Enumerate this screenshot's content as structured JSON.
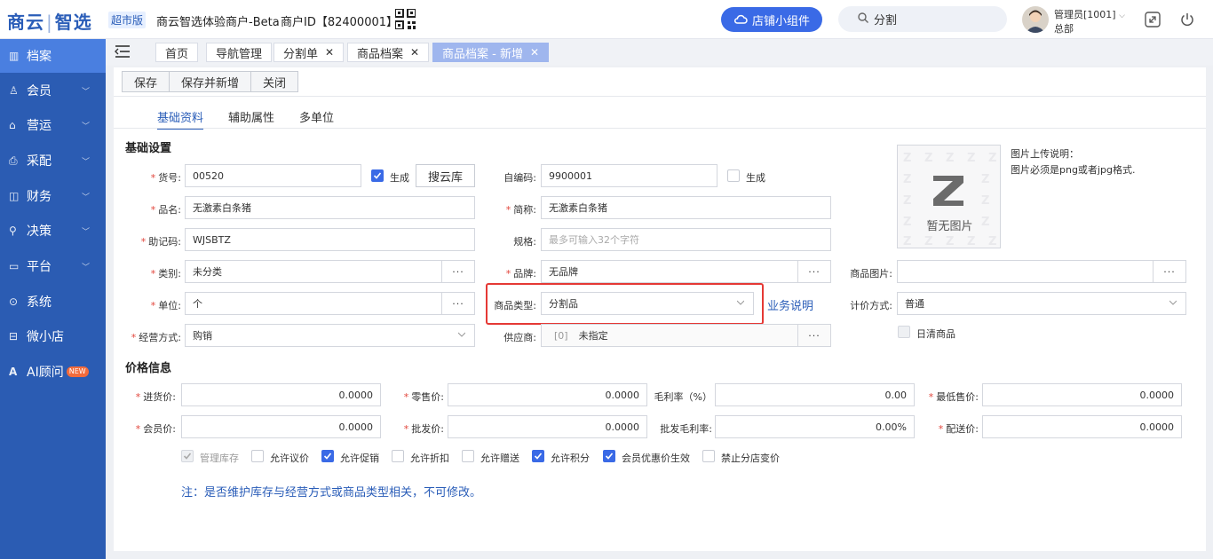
{
  "header": {
    "logo_left": "商云",
    "logo_right": "智选",
    "edition": "超市版",
    "merchant": "商云智选体验商户-Beta",
    "merchant_id": "商户ID【82400001】",
    "widget_button": "店铺小组件",
    "search_value": "分割",
    "user_name": "管理员[1001]",
    "user_org": "总部"
  },
  "sidebar": {
    "items": [
      {
        "label": "档案",
        "icon": "archive-icon"
      },
      {
        "label": "会员",
        "icon": "member-icon"
      },
      {
        "label": "营运",
        "icon": "store-icon"
      },
      {
        "label": "采配",
        "icon": "purchase-icon"
      },
      {
        "label": "财务",
        "icon": "finance-icon"
      },
      {
        "label": "决策",
        "icon": "decision-icon"
      },
      {
        "label": "平台",
        "icon": "platform-icon"
      },
      {
        "label": "系统",
        "icon": "system-icon"
      },
      {
        "label": "微小店",
        "icon": "microshop-icon"
      },
      {
        "label": "AI顾问",
        "icon": "ai-icon",
        "badge": "NEW"
      }
    ]
  },
  "tabs": [
    {
      "label": "首页"
    },
    {
      "label": "导航管理"
    },
    {
      "label": "分割单"
    },
    {
      "label": "商品档案"
    },
    {
      "label": "商品档案 - 新增"
    }
  ],
  "toolbar": {
    "save": "保存",
    "save_new": "保存并新增",
    "close": "关闭"
  },
  "subtabs": [
    "基础资料",
    "辅助属性",
    "多单位"
  ],
  "basic": {
    "title": "基础设置",
    "code_label": "货号:",
    "code_value": "00520",
    "generate_label": "生成",
    "search_lib_button": "搜云库",
    "barcode_label": "自编码:",
    "barcode_value": "9900001",
    "generate2_label": "生成",
    "name_label": "品名:",
    "name_value": "无激素白条猪",
    "short_label": "简称:",
    "short_value": "无激素白条猪",
    "mnemonic_label": "助记码:",
    "mnemonic_value": "WJSBTZ",
    "spec_label": "规格:",
    "spec_placeholder": "最多可输入32个字符",
    "category_label": "类别:",
    "category_value": "未分类",
    "brand_label": "品牌:",
    "brand_value": "无品牌",
    "image_label": "商品图片:",
    "unit_label": "单位:",
    "unit_value": "个",
    "type_label": "商品类型:",
    "type_value": "分割品",
    "business_link": "业务说明",
    "pricing_label": "计价方式:",
    "pricing_value": "普通",
    "mode_label": "经营方式:",
    "mode_value": "购销",
    "supplier_label": "供应商:",
    "supplier_code": "[0]",
    "supplier_value": "未指定",
    "daily_clear_label": "日清商品",
    "ellipsis": "···"
  },
  "image": {
    "no_image": "暂无图片",
    "note_title": "图片上传说明：",
    "note_body": "图片必须是png或者jpg格式."
  },
  "price": {
    "title": "价格信息",
    "purchase_label": "进货价:",
    "purchase_value": "0.0000",
    "retail_label": "零售价:",
    "retail_value": "0.0000",
    "margin_label": "毛利率（%）",
    "margin_value": "0.00",
    "min_label": "最低售价:",
    "min_value": "0.0000",
    "member_label": "会员价:",
    "member_value": "0.0000",
    "wholesale_label": "批发价:",
    "wholesale_value": "0.0000",
    "wholesale_margin_label": "批发毛利率:",
    "wholesale_margin_value": "0.00%",
    "delivery_label": "配送价:",
    "delivery_value": "0.0000"
  },
  "options": [
    {
      "label": "管理库存",
      "checked": true,
      "disabled": true
    },
    {
      "label": "允许议价",
      "checked": false
    },
    {
      "label": "允许促销",
      "checked": true
    },
    {
      "label": "允许折扣",
      "checked": false
    },
    {
      "label": "允许赠送",
      "checked": false
    },
    {
      "label": "允许积分",
      "checked": true
    },
    {
      "label": "会员优惠价生效",
      "checked": true
    },
    {
      "label": "禁止分店变价",
      "checked": false
    }
  ],
  "note": "注：是否维护库存与经营方式或商品类型相关，不可修改。"
}
